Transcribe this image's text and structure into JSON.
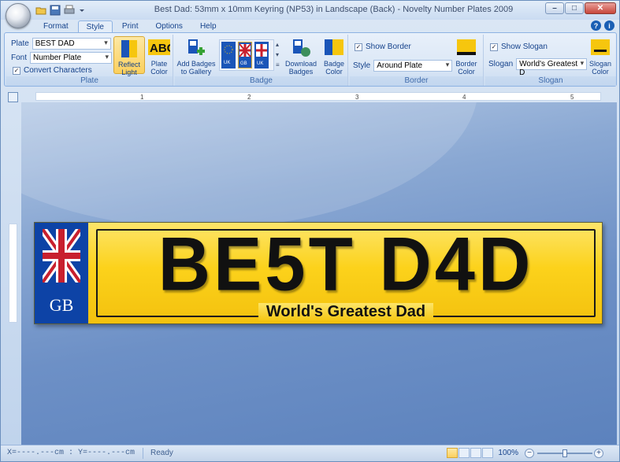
{
  "window": {
    "title": "Best Dad: 53mm x 10mm Keyring (NP53) in Landscape (Back) - Novelty Number Plates 2009"
  },
  "tabs": [
    {
      "label": "Format"
    },
    {
      "label": "Style"
    },
    {
      "label": "Print"
    },
    {
      "label": "Options"
    },
    {
      "label": "Help"
    }
  ],
  "ribbon": {
    "plate_group": {
      "label": "Plate",
      "plate_label": "Plate",
      "plate_value": "BEST DAD",
      "font_label": "Font",
      "font_value": "Number Plate",
      "convert_label": "Convert Characters",
      "reflect_label_1": "Reflect",
      "reflect_label_2": "Light",
      "plate_color_label_1": "Plate",
      "plate_color_label_2": "Color"
    },
    "badge_group": {
      "label": "Badge",
      "add_badges_1": "Add Badges",
      "add_badges_2": "to Gallery",
      "download_1": "Download",
      "download_2": "Badges",
      "badge_color_1": "Badge",
      "badge_color_2": "Color"
    },
    "border_group": {
      "label": "Border",
      "show_border_label": "Show Border",
      "style_label": "Style",
      "style_value": "Around Plate",
      "border_color_1": "Border",
      "border_color_2": "Color"
    },
    "slogan_group": {
      "label": "Slogan",
      "show_slogan_label": "Show Slogan",
      "slogan_label": "Slogan",
      "slogan_value": "World's Greatest D",
      "slogan_color_1": "Slogan",
      "slogan_color_2": "Color"
    }
  },
  "ruler": {
    "marks": [
      "1",
      "2",
      "3",
      "4",
      "5"
    ]
  },
  "plate": {
    "text": "BE5T D4D",
    "badge_text": "GB",
    "slogan": "World's Greatest Dad",
    "colors": {
      "plate": "#fcd21b",
      "badge": "#0d43a6",
      "text": "#111111"
    }
  },
  "status": {
    "coords": "X=----.---cm : Y=----.---cm",
    "state": "Ready",
    "zoom": "100%"
  }
}
